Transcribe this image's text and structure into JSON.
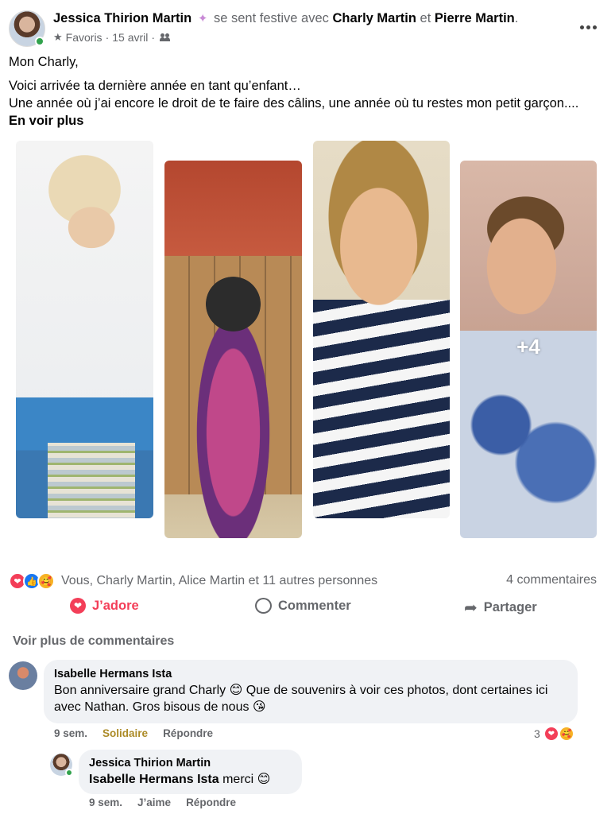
{
  "post": {
    "author": "Jessica Thirion Martin",
    "status_text": "se sent festive avec",
    "tag_1": "Charly Martin",
    "conjunction": "et",
    "tag_2": "Pierre Martin",
    "period": ".",
    "audience": "Favoris",
    "separator": "·",
    "date": "15 avril",
    "greeting": "Mon Charly,",
    "body_line_1": "Voici arrivée ta dernière année en tant qu’enfant…",
    "body_line_2": "Une année où j’ai encore le droit de te faire des câlins, une année où tu restes mon petit garçon.... ",
    "see_more": "En voir plus"
  },
  "photos": {
    "more_count": "+4"
  },
  "icons": {
    "star": "★",
    "love": "❤",
    "like": "👍",
    "care": "🥰",
    "share": "➦"
  },
  "reactions": {
    "summary": "Vous, Charly Martin, Alice Martin et 11 autres personnes",
    "comments_count": "4 commentaires"
  },
  "actions": {
    "love_label": "J’adore",
    "comment_label": "Commenter",
    "share_label": "Partager"
  },
  "comments": {
    "view_more": "Voir plus de commentaires",
    "c1": {
      "author": "Isabelle Hermans Ista",
      "text": "Bon anniversaire grand Charly 😊 Que de souvenirs à voir ces photos, dont certaines ici avec Nathan. Gros bisous de nous 😘",
      "time": "9 sem.",
      "reaction_label": "Solidaire",
      "reply_label": "Répondre",
      "reaction_count": "3"
    },
    "c2": {
      "author": "Jessica Thirion Martin",
      "mention": "Isabelle Hermans Ista",
      "text": " merci 😊",
      "time": "9 sem.",
      "like_label": "J’aime",
      "reply_label": "Répondre"
    }
  },
  "colors": {
    "love": "#f33e58",
    "like": "#1877f2",
    "muted": "#65676b",
    "solidaire": "#ac8b27",
    "online": "#31a24c"
  }
}
